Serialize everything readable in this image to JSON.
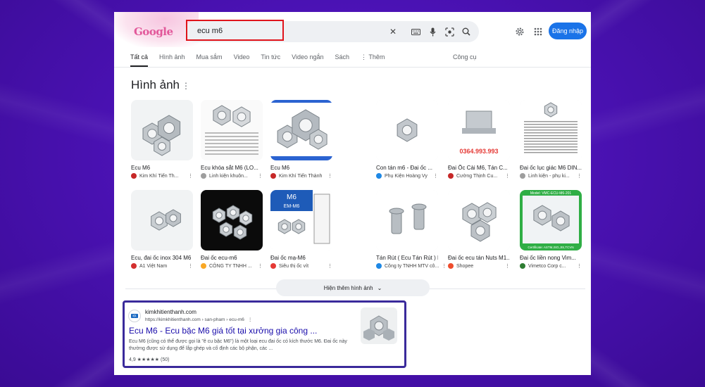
{
  "search": {
    "query": "ecu m6",
    "logo": "Google"
  },
  "header": {
    "login_label": "Đăng nhập"
  },
  "tabs": [
    "Tất cả",
    "Hình ảnh",
    "Mua sắm",
    "Video",
    "Tin tức",
    "Video ngắn",
    "Sách",
    "⋮ Thêm"
  ],
  "tools_label": "Công cụ",
  "images_section": {
    "title": "Hình ảnh",
    "show_more_label": "Hiện thêm hình ảnh",
    "items": [
      {
        "caption": "Ecu M6",
        "source": "Kim Khí Tiến Th...",
        "fav": "#c62828"
      },
      {
        "caption": "Ecu khóa sắt M6 (LO...",
        "source": "Linh kiện khuôn...",
        "fav": "#9e9e9e"
      },
      {
        "caption": "Ecu M6",
        "source": "Kim Khí Tiến Thành",
        "fav": "#c62828"
      },
      {
        "caption": "Con tán m6 - Đai ốc ...",
        "source": "Phụ Kiện Hoàng Vy",
        "fav": "#1e88e5"
      },
      {
        "caption": "Đai Ốc Cài M6, Tán C...",
        "source": "Cường Thịnh Cu...",
        "fav": "#c62828"
      },
      {
        "caption": "Đai ốc lục giác M6 DIN...",
        "source": "Linh kiện - phụ ki...",
        "fav": "#9e9e9e"
      },
      {
        "caption": "Ecu, đai ốc inox 304 M6",
        "source": "A1 Việt Nam",
        "fav": "#d32f2f"
      },
      {
        "caption": "Đai ốc ecu-m6",
        "source": "CÔNG TY TNHH ...",
        "fav": "#f9a825"
      },
      {
        "caption": "Đai ốc mạ-M6",
        "source": "Siêu thị ốc vít",
        "fav": "#e53935"
      },
      {
        "caption": "Tán Rút ( Ecu Tán Rút ) M6 ...",
        "source": "Công ty TNHH MTV cô...",
        "fav": "#1e88e5"
      },
      {
        "caption": "Đai ốc ecu tán Nuts M1...",
        "source": "Shopee",
        "fav": "#ee4d2d"
      },
      {
        "caption": "Đai ốc liền nong Vim...",
        "source": "Vimetco Corp c...",
        "fav": "#2e7d32"
      }
    ],
    "thumb_labels": {
      "phone": "0364.993.993",
      "m6_title": "M6",
      "m6_sub": "EM-M6",
      "vmc_top": "Model: VMC-ECU-M6-201",
      "vmc_bottom": "Certificate: ASTM,ISO,JIS,TCVN"
    }
  },
  "result": {
    "site_name": "kimkhitienthanh.com",
    "url": "https://kimkhitienthanh.com › san-pham › ecu-m6",
    "title": "Ecu M6 - Ecu bặc M6 giá tốt tại xưởng gia công ...",
    "snippet": "Ecu M6 (cũng có thể được gọi là \"ê cu bặc M6\") là một loại ecu đai ốc có kích thước M6. Đai ốc này thường được sử dụng để lắp ghép và cố định các bộ phận, các ...",
    "rating": "4,9 ★★★★★ (50)"
  },
  "colors": {
    "accent": "#1a73e8",
    "highlight_red": "#e0141b",
    "highlight_purple": "#3a2a9b"
  }
}
